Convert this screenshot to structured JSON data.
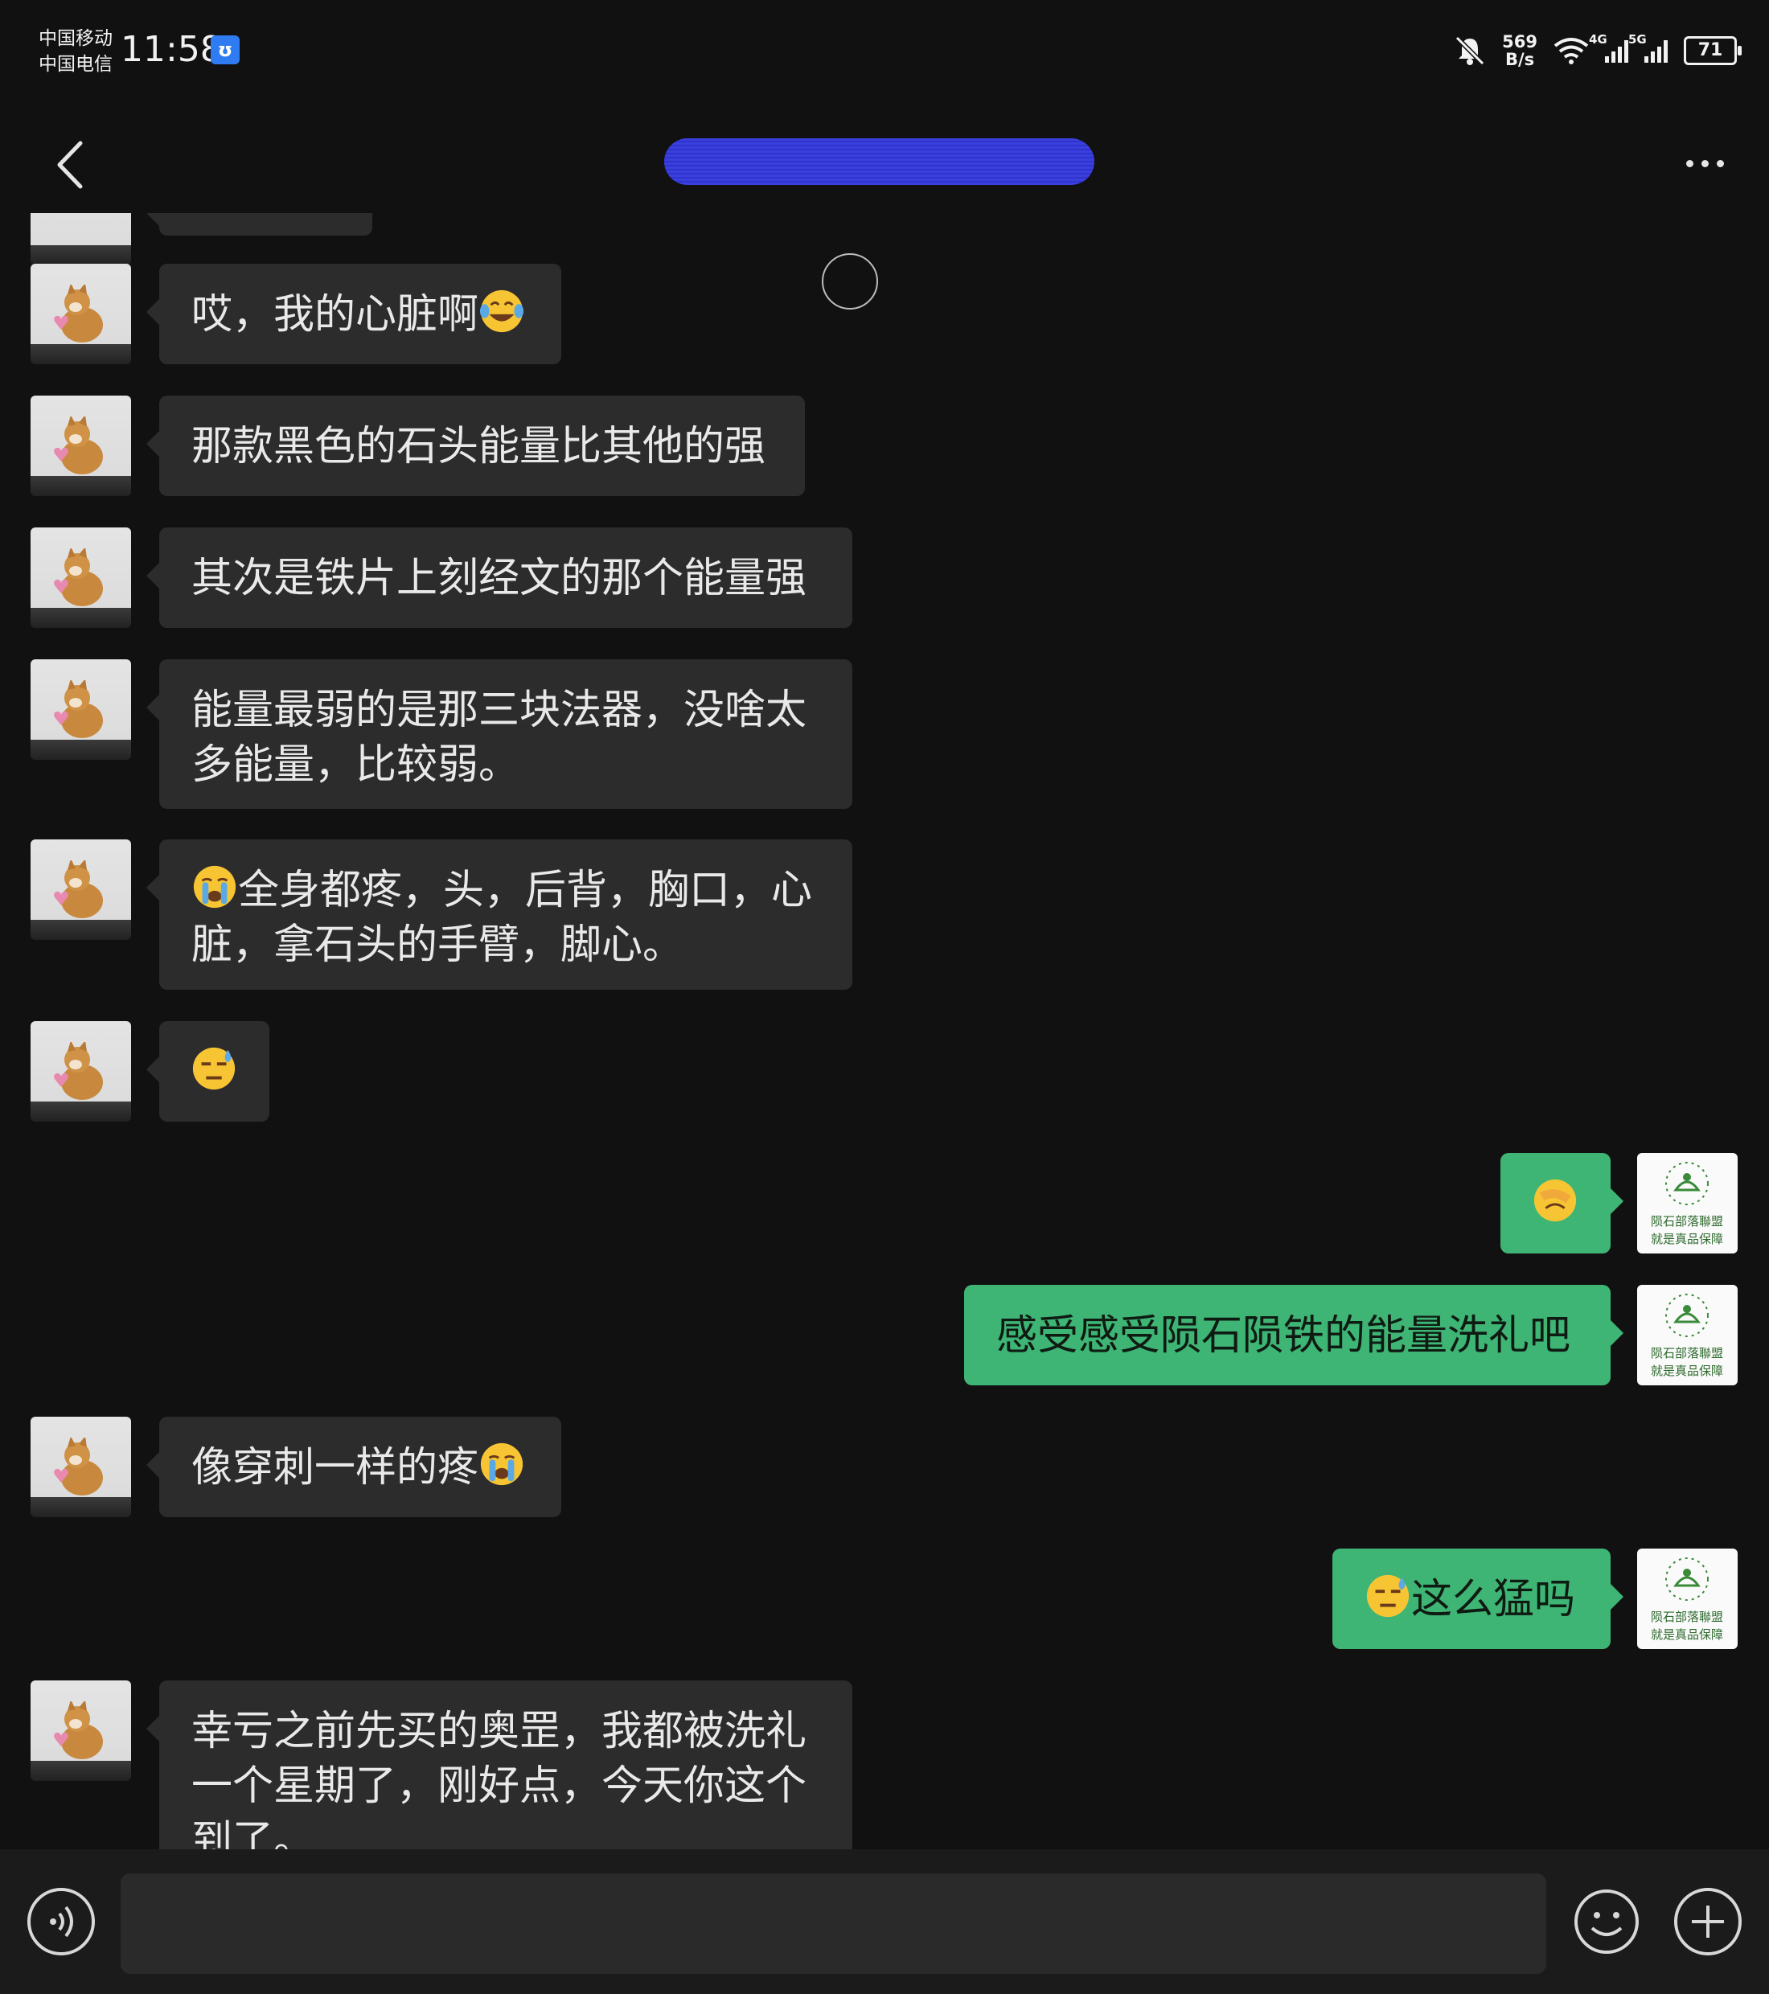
{
  "status_bar": {
    "carrier_1": "中国移动",
    "carrier_2": "中国电信",
    "time": "11:58",
    "net_speed_value": "569",
    "net_speed_unit": "B/s",
    "net_tag_1": "4G",
    "net_tag_2": "5G",
    "battery": "71",
    "icons": [
      "app-notification-icon",
      "mute-bell-icon",
      "wifi-icon",
      "signal-icon",
      "signal-icon",
      "battery-icon"
    ]
  },
  "header": {
    "title_redacted": true,
    "icons": [
      "back-arrow-icon",
      "more-dots-icon"
    ]
  },
  "messages": [
    {
      "side": "in",
      "text": "哎，我的心脏啊",
      "emoji_after": "laugh-cry"
    },
    {
      "side": "in",
      "text": "那款黑色的石头能量比其他的强"
    },
    {
      "side": "in",
      "text": "其次是铁片上刻经文的那个能量强"
    },
    {
      "side": "in",
      "text": "能量最弱的是那三块法器，没啥太\n多能量，比较弱。"
    },
    {
      "side": "in",
      "text": "全身都疼，头，后背，胸口，心\n脏，拿石头的手臂，脚心。",
      "emoji_before": "crying"
    },
    {
      "side": "in",
      "text": "",
      "emoji_only": "sweat"
    },
    {
      "side": "out",
      "text": "",
      "emoji_only": "facepalm"
    },
    {
      "side": "out",
      "text": "感受感受陨石陨铁的能量洗礼吧"
    },
    {
      "side": "in",
      "text": "像穿刺一样的疼",
      "emoji_after": "crying"
    },
    {
      "side": "out",
      "text": "这么猛吗",
      "emoji_before": "sweat"
    },
    {
      "side": "in",
      "text": "幸亏之前先买的奥罡，我都被洗礼\n一个星期了，刚好点，今天你这个\n到了。"
    }
  ],
  "avatar_logo_text": "陨石部落聯盟 就是真品保障",
  "input_bar": {
    "placeholder": "",
    "icons": [
      "voice-icon",
      "emoji-icon",
      "plus-icon"
    ]
  },
  "colors": {
    "background": "#111111",
    "incoming_bubble": "#2c2c2c",
    "outgoing_bubble": "#3eb575",
    "title_redaction": "#3a3fe0"
  }
}
